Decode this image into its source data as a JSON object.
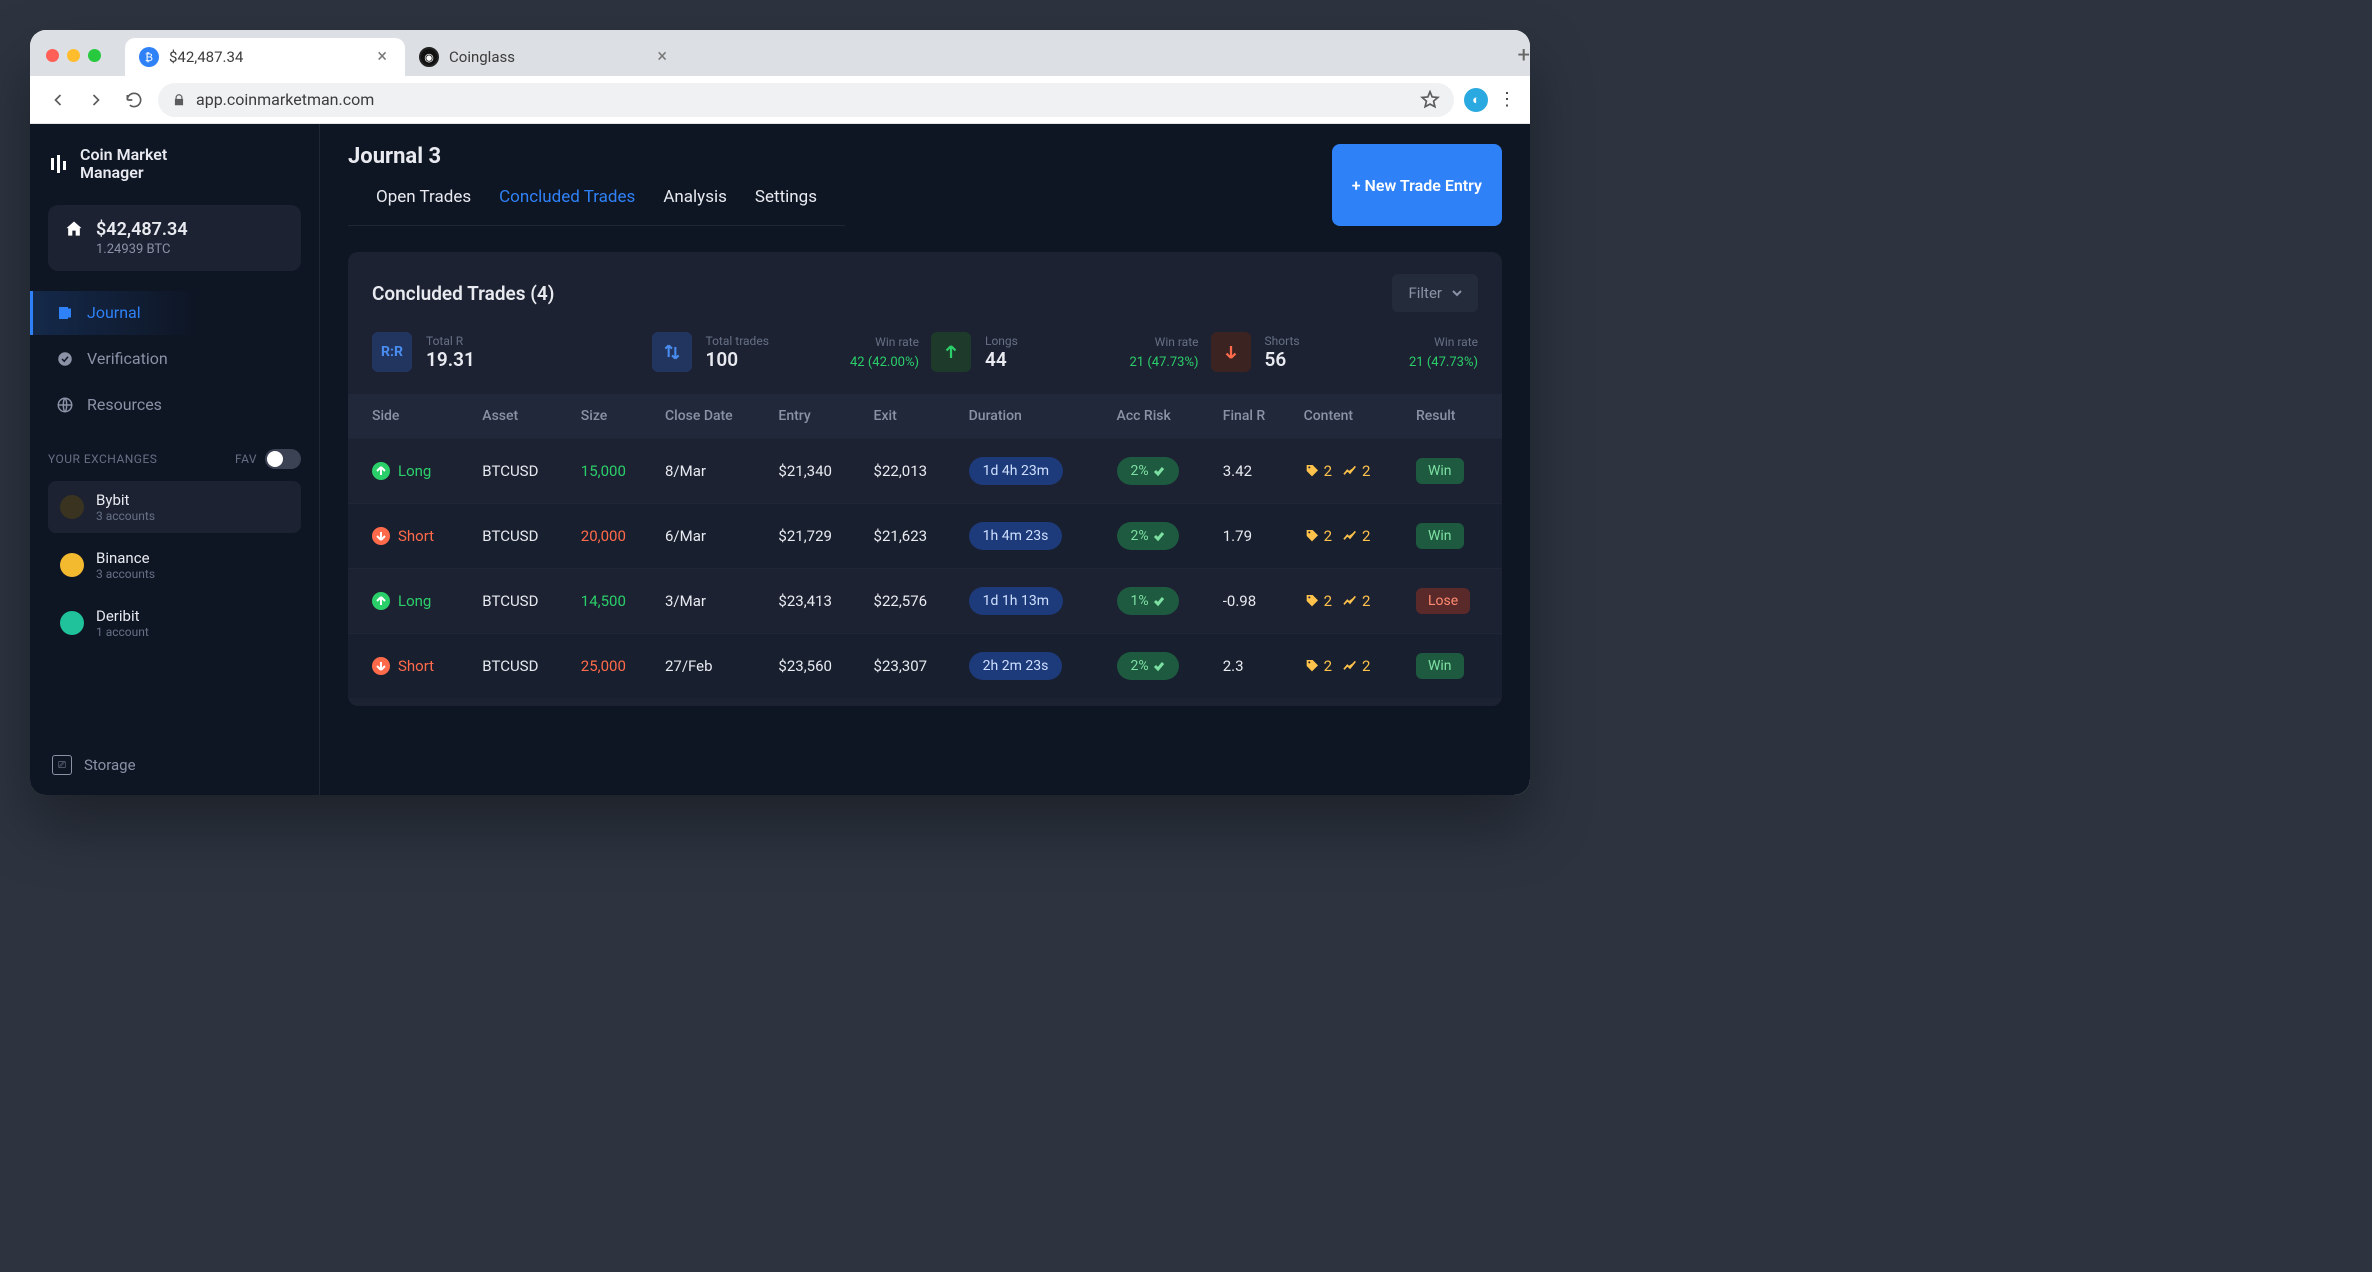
{
  "browser": {
    "tabs": [
      {
        "title": "$42,487.34",
        "active": true,
        "favicon_color": "#2f81f7"
      },
      {
        "title": "Coinglass",
        "active": false,
        "favicon_color": "#111"
      }
    ],
    "url": "app.coinmarketman.com"
  },
  "sidebar": {
    "brand_line1": "Coin Market",
    "brand_line2": "Manager",
    "balance_usd": "$42,487.34",
    "balance_btc": "1.24939 BTC",
    "nav": [
      {
        "label": "Journal",
        "active": true
      },
      {
        "label": "Verification",
        "active": false
      },
      {
        "label": "Resources",
        "active": false
      }
    ],
    "exchanges_label": "YOUR EXCHANGES",
    "fav_label": "FAV",
    "exchanges": [
      {
        "name": "Bybit",
        "sub": "3 accounts",
        "active": true,
        "color": "#3a3320"
      },
      {
        "name": "Binance",
        "sub": "3 accounts",
        "active": false,
        "color": "#f3ba2f"
      },
      {
        "name": "Deribit",
        "sub": "1 account",
        "active": false,
        "color": "#1fc29a"
      }
    ],
    "storage_label": "Storage"
  },
  "header": {
    "page_title": "Journal 3",
    "new_entry": "+ New Trade Entry",
    "tabs": [
      {
        "label": "Open Trades",
        "active": false
      },
      {
        "label": "Concluded Trades",
        "active": true
      },
      {
        "label": "Analysis",
        "active": false
      },
      {
        "label": "Settings",
        "active": false
      }
    ]
  },
  "panel": {
    "title": "Concluded Trades (4)",
    "filter": "Filter",
    "stats": {
      "total_r": {
        "label": "Total R",
        "value": "19.31"
      },
      "total_trades": {
        "label": "Total trades",
        "value": "100",
        "win_label": "Win rate",
        "win_value": "42 (42.00%)"
      },
      "longs": {
        "label": "Longs",
        "value": "44",
        "win_label": "Win rate",
        "win_value": "21 (47.73%)"
      },
      "shorts": {
        "label": "Shorts",
        "value": "56",
        "win_label": "Win rate",
        "win_value": "21 (47.73%)"
      }
    },
    "columns": [
      "Side",
      "Asset",
      "Size",
      "Close Date",
      "Entry",
      "Exit",
      "Duration",
      "Acc Risk",
      "Final R",
      "Content",
      "Result"
    ],
    "rows": [
      {
        "side": "Long",
        "asset": "BTCUSD",
        "size": "15,000",
        "close": "8/Mar",
        "entry": "$21,340",
        "exit": "$22,013",
        "duration": "1d 4h 23m",
        "risk": "2%",
        "finalr": "3.42",
        "tags": "2",
        "charts": "2",
        "result": "Win"
      },
      {
        "side": "Short",
        "asset": "BTCUSD",
        "size": "20,000",
        "close": "6/Mar",
        "entry": "$21,729",
        "exit": "$21,623",
        "duration": "1h 4m 23s",
        "risk": "2%",
        "finalr": "1.79",
        "tags": "2",
        "charts": "2",
        "result": "Win"
      },
      {
        "side": "Long",
        "asset": "BTCUSD",
        "size": "14,500",
        "close": "3/Mar",
        "entry": "$23,413",
        "exit": "$22,576",
        "duration": "1d 1h 13m",
        "risk": "1%",
        "finalr": "-0.98",
        "tags": "2",
        "charts": "2",
        "result": "Lose"
      },
      {
        "side": "Short",
        "asset": "BTCUSD",
        "size": "25,000",
        "close": "27/Feb",
        "entry": "$23,560",
        "exit": "$23,307",
        "duration": "2h 2m 23s",
        "risk": "2%",
        "finalr": "2.3",
        "tags": "2",
        "charts": "2",
        "result": "Win"
      }
    ]
  }
}
